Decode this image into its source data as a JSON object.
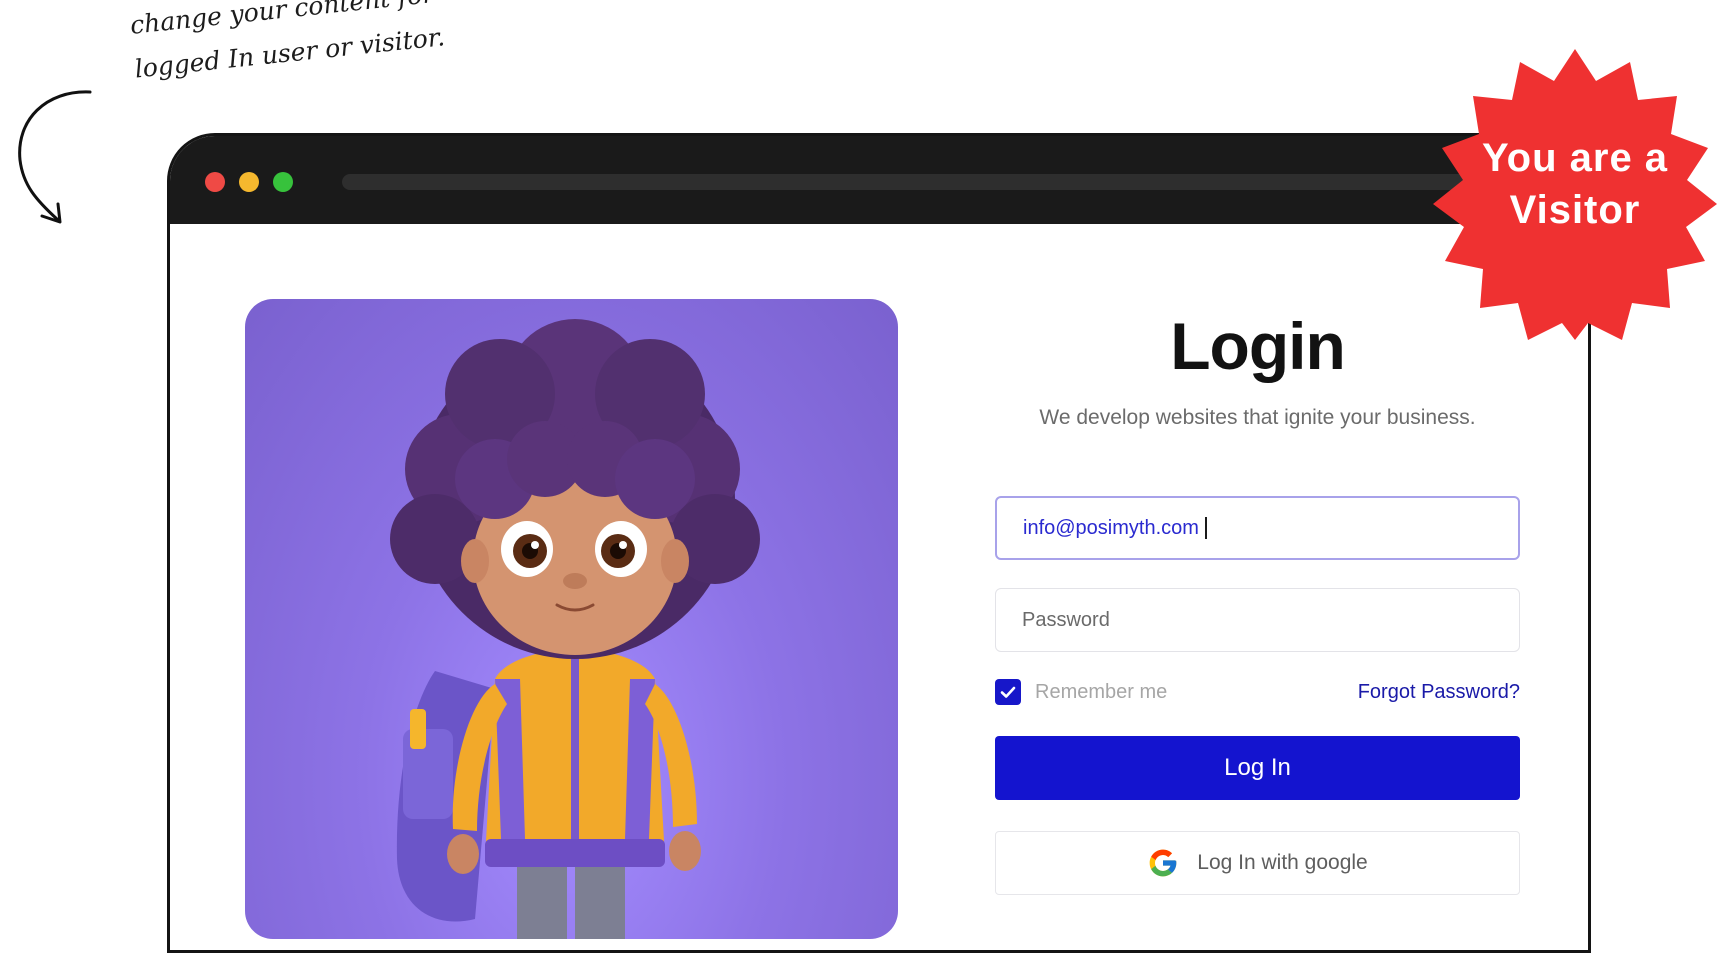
{
  "annotation": {
    "line1": "change your content for",
    "line2": "logged In user or visitor."
  },
  "badge": {
    "line1": "You are a",
    "line2": "Visitor",
    "color": "#ef3131"
  },
  "login": {
    "title": "Login",
    "subtitle": "We develop websites that ignite your business.",
    "email_value": "info@posimyth.com",
    "password_placeholder": "Password",
    "remember_label": "Remember me",
    "remember_checked": true,
    "forgot_label": "Forgot Password?",
    "login_button": "Log In",
    "google_button": "Log In with google"
  },
  "colors": {
    "primary": "#1414cf",
    "hero_bg": "#8d73e6",
    "titlebar": "#1a1a1a"
  },
  "icons": [
    "arrow-annotation-icon",
    "google-icon",
    "check-icon",
    "window-dot-red-icon",
    "window-dot-yellow-icon",
    "window-dot-green-icon"
  ]
}
